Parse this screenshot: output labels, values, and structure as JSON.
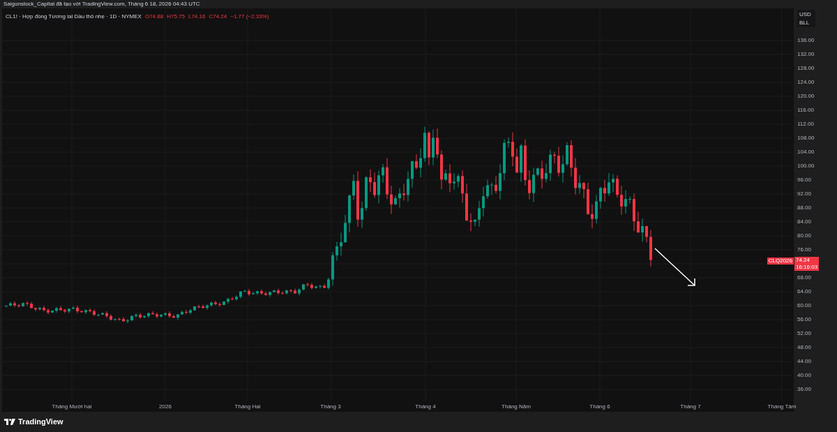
{
  "header": {
    "title": "Saigonstock_Capital đã tạo với TradingView.com, Tháng 6 18, 2026 04:43 UTC"
  },
  "legend": {
    "symbol": "CL1! · Hợp đồng Tương lai Dầu thô nhẹ · 1D · NYMEX",
    "values": [
      "O74.88",
      "H75.75",
      "L74.16",
      "C74.24",
      "−1.77 (−2.33%)"
    ]
  },
  "price_scale": {
    "currency": "USD",
    "unit": "BLL",
    "items": [
      {
        "kind": "tick",
        "label": "136.00"
      },
      {
        "kind": "tick",
        "label": "132.00"
      },
      {
        "kind": "tick",
        "label": "128.00"
      },
      {
        "kind": "tick",
        "label": "124.00"
      },
      {
        "kind": "tick",
        "label": "120.00"
      },
      {
        "kind": "tick",
        "label": "116.00"
      },
      {
        "kind": "tick",
        "label": "112.00"
      },
      {
        "kind": "tick",
        "label": "108.00"
      },
      {
        "kind": "tick",
        "label": "104.00"
      },
      {
        "kind": "tick",
        "label": "100.00"
      },
      {
        "kind": "tick",
        "label": "96.00"
      },
      {
        "kind": "tick",
        "label": "92.00"
      },
      {
        "kind": "tick",
        "label": "88.00"
      },
      {
        "kind": "tick",
        "label": "84.00"
      },
      {
        "kind": "tick",
        "label": "80.00"
      },
      {
        "kind": "tick",
        "label": "76.00"
      },
      {
        "kind": "price_label",
        "symbol": "CLQ2026",
        "price": "74.24",
        "countdown": "16:16:03"
      },
      {
        "kind": "tick",
        "label": "68.00"
      },
      {
        "kind": "tick",
        "label": "64.00"
      },
      {
        "kind": "tick",
        "label": "60.00"
      },
      {
        "kind": "tick",
        "label": "56.00"
      },
      {
        "kind": "tick",
        "label": "52.00"
      },
      {
        "kind": "tick",
        "label": "48.00"
      },
      {
        "kind": "tick",
        "label": "44.00"
      },
      {
        "kind": "tick",
        "label": "40.00"
      },
      {
        "kind": "tick",
        "label": "36.00"
      }
    ]
  },
  "time_axis": {
    "labels": [
      "Tháng Mười hai",
      "2026",
      "Tháng Hai",
      "Tháng 3",
      "Tháng 4",
      "Tháng Năm",
      "Tháng 6",
      "Tháng 7",
      "Tháng Tám"
    ]
  },
  "footer": {
    "brand": "TradingView"
  }
}
